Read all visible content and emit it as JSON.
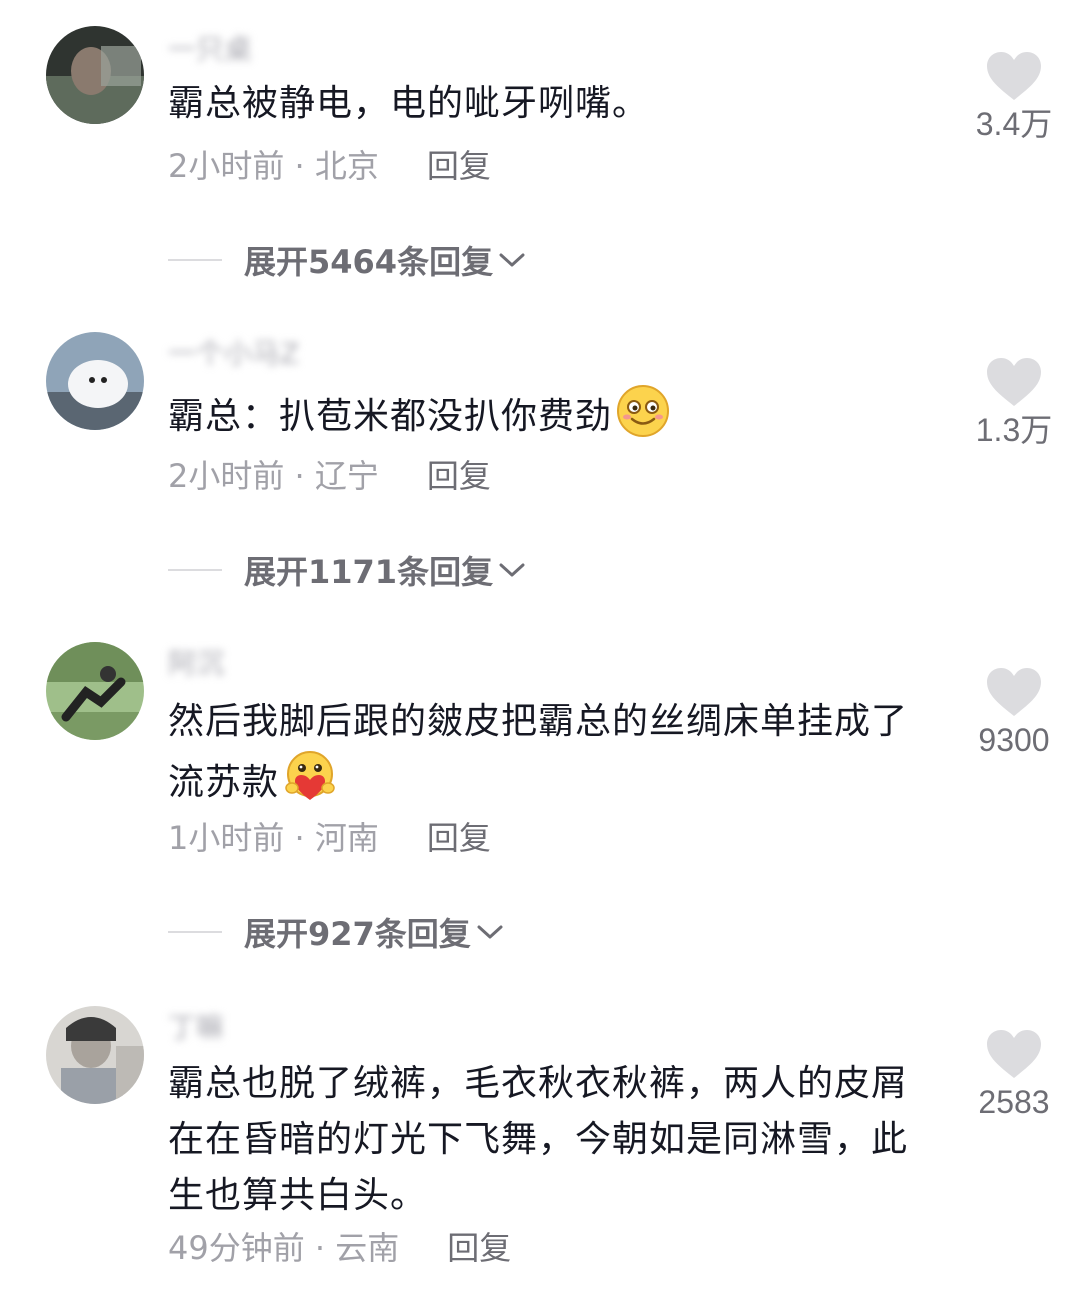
{
  "comments": [
    {
      "username": "一只桌",
      "text": "霸总被静电，电的呲牙咧嘴。",
      "time_location": "2小时前 · 北京",
      "reply_label": "回复",
      "expand_label": "展开5464条回复",
      "likes": "3.4万",
      "avatar_colors": [
        "#3a3f3a",
        "#7d8a7a"
      ]
    },
    {
      "username": "一个小马Z",
      "text": "霸总：扒苞米都没扒你费劲",
      "emoji": "smile-emoji",
      "time_location": "2小时前 · 辽宁",
      "reply_label": "回复",
      "expand_label": "展开1171条回复",
      "likes": "1.3万",
      "avatar_colors": [
        "#8fa4b8",
        "#f2f4f6"
      ]
    },
    {
      "username": "阿沉",
      "text": "然后我脚后跟的皴皮把霸总的丝绸床单挂成了流苏款",
      "emoji": "heart-hug-emoji",
      "time_location": "1小时前 · 河南",
      "reply_label": "回复",
      "expand_label": "展开927条回复",
      "likes": "9300",
      "avatar_colors": [
        "#6f8f5a",
        "#2a2a2a"
      ]
    },
    {
      "username": "丁嘛",
      "text": "霸总也脱了绒裤，毛衣秋衣秋裤，两人的皮屑在在昏暗的灯光下飞舞，今朝如是同淋雪，此生也算共白头。",
      "time_location": "49分钟前 · 云南",
      "reply_label": "回复",
      "likes": "2583",
      "avatar_colors": [
        "#9aa0a8",
        "#d8d6d2"
      ]
    }
  ],
  "colors": {
    "primary_text": "#161823",
    "secondary_text": "#a1a1a8",
    "heart": "#dcdcdf"
  }
}
